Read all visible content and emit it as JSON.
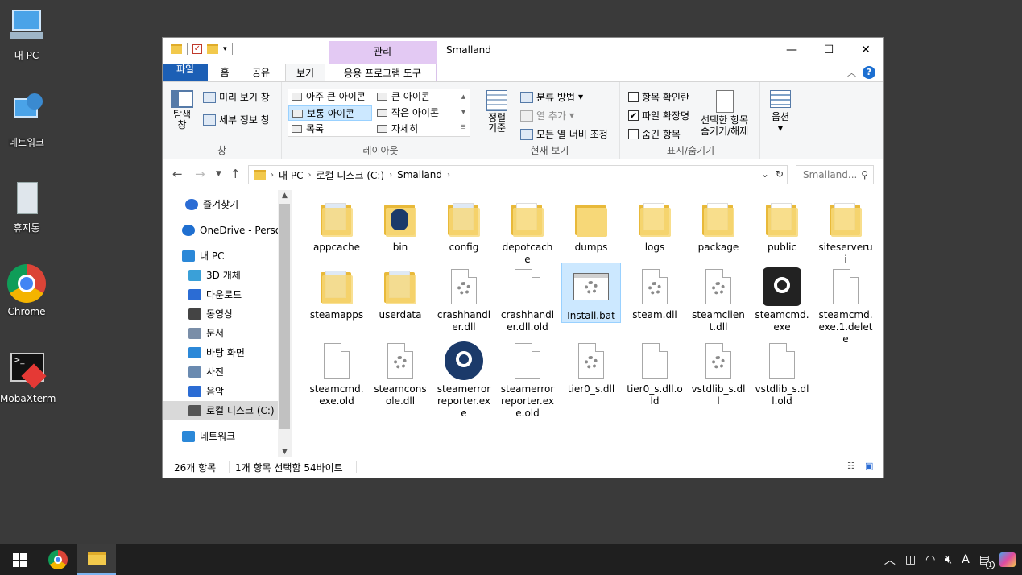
{
  "desktop": {
    "icons": [
      {
        "label": "내 PC",
        "icon": "computer-icon"
      },
      {
        "label": "네트워크",
        "icon": "network-icon"
      },
      {
        "label": "휴지통",
        "icon": "recycle-bin-icon"
      },
      {
        "label": "Chrome",
        "icon": "chrome-icon"
      },
      {
        "label": "MobaXterm",
        "icon": "mobaxterm-icon"
      }
    ]
  },
  "window": {
    "title": "Smalland",
    "manage_tab": "관리",
    "controls": {
      "minimize": "—",
      "maximize": "☐",
      "close": "✕"
    }
  },
  "ribbon": {
    "tabs": {
      "file": "파일",
      "home": "홈",
      "share": "공유",
      "view": "보기",
      "app_tools": "응용 프로그램 도구"
    },
    "pane_group": {
      "nav_pane_label": "탐색\n창",
      "preview_pane": "미리 보기 창",
      "details_pane": "세부 정보 창",
      "group_label": "창"
    },
    "layout_group": {
      "items": [
        "아주 큰 아이콘",
        "큰 아이콘",
        "보통 아이콘",
        "작은 아이콘",
        "목록",
        "자세히"
      ],
      "selected": "보통 아이콘",
      "group_label": "레이아웃"
    },
    "current_view_group": {
      "sort_label": "정렬\n기준",
      "group_by": "분류 방법",
      "add_columns": "열 추가",
      "fit_columns": "모든 열 너비 조정",
      "group_label": "현재 보기"
    },
    "show_hide_group": {
      "item_checkboxes": "항목 확인란",
      "item_checkboxes_checked": false,
      "file_extensions": "파일 확장명",
      "file_extensions_checked": true,
      "hidden_items": "숨긴 항목",
      "hidden_items_checked": false,
      "hide_selected": "선택한 항목\n숨기기/해제",
      "group_label": "표시/숨기기"
    },
    "options": "옵션"
  },
  "address": {
    "crumbs": [
      "내 PC",
      "로컬 디스크 (C:)",
      "Smalland"
    ],
    "search_placeholder": "Smalland..."
  },
  "navpane": {
    "items": [
      {
        "label": "즐겨찾기",
        "icon": "star-icon",
        "color": "#2b6cd4"
      },
      {
        "label": "OneDrive - Personal",
        "icon": "cloud-icon",
        "color": "#1f6fd0"
      },
      {
        "label": "내 PC",
        "icon": "computer-icon",
        "color": "#2b88d8"
      },
      {
        "label": "3D 개체",
        "icon": "cube-icon",
        "color": "#3aa0d8"
      },
      {
        "label": "다운로드",
        "icon": "download-icon",
        "color": "#2b6cd4"
      },
      {
        "label": "동영상",
        "icon": "film-icon",
        "color": "#444444"
      },
      {
        "label": "문서",
        "icon": "document-icon",
        "color": "#7a8ea8"
      },
      {
        "label": "바탕 화면",
        "icon": "desktop-icon",
        "color": "#2b88d8"
      },
      {
        "label": "사진",
        "icon": "picture-icon",
        "color": "#6a8ab0"
      },
      {
        "label": "음악",
        "icon": "music-icon",
        "color": "#2b6cd4"
      },
      {
        "label": "로컬 디스크 (C:)",
        "icon": "drive-icon",
        "color": "#555555"
      },
      {
        "label": "네트워크",
        "icon": "network-icon",
        "color": "#2b88d8"
      }
    ]
  },
  "files": [
    {
      "name": "appcache",
      "type": "folder-doc"
    },
    {
      "name": "bin",
      "type": "folder-steam"
    },
    {
      "name": "config",
      "type": "folder-doc"
    },
    {
      "name": "depotcache",
      "type": "folder-paper"
    },
    {
      "name": "dumps",
      "type": "folder"
    },
    {
      "name": "logs",
      "type": "folder-paper"
    },
    {
      "name": "package",
      "type": "folder-paper"
    },
    {
      "name": "public",
      "type": "folder-paper"
    },
    {
      "name": "siteserverui",
      "type": "folder-paper"
    },
    {
      "name": "steamapps",
      "type": "folder-doc"
    },
    {
      "name": "userdata",
      "type": "folder-doc"
    },
    {
      "name": "crashhandler.dll",
      "type": "dll"
    },
    {
      "name": "crashhandler.dll.old",
      "type": "doc"
    },
    {
      "name": "Install.bat",
      "type": "bat"
    },
    {
      "name": "steam.dll",
      "type": "dll"
    },
    {
      "name": "steamclient.dll",
      "type": "dll"
    },
    {
      "name": "steamcmd.exe",
      "type": "steam-sq"
    },
    {
      "name": "steamcmd.exe.1.delete",
      "type": "doc"
    },
    {
      "name": "steamcmd.exe.old",
      "type": "doc"
    },
    {
      "name": "steamconsole.dll",
      "type": "dll"
    },
    {
      "name": "steamerrorreporter.exe",
      "type": "steam-ci"
    },
    {
      "name": "steamerrorreporter.exe.old",
      "type": "doc"
    },
    {
      "name": "tier0_s.dll",
      "type": "dll"
    },
    {
      "name": "tier0_s.dll.old",
      "type": "doc"
    },
    {
      "name": "vstdlib_s.dll",
      "type": "dll"
    },
    {
      "name": "vstdlib_s.dll.old",
      "type": "doc"
    }
  ],
  "selected_file": "Install.bat",
  "status": {
    "count": "26개 항목",
    "selection": "1개 항목 선택함 54바이트"
  },
  "tray": {
    "ime": "A",
    "notifications": "1"
  }
}
